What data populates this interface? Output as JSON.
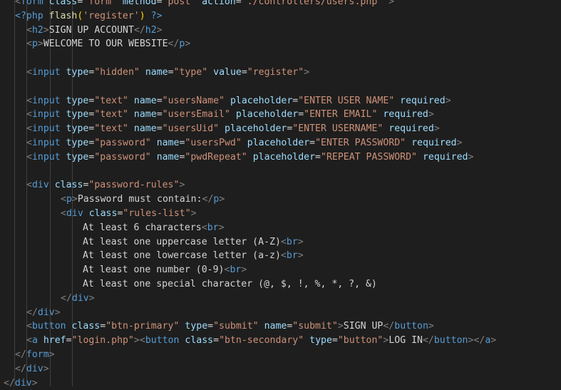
{
  "colors": {
    "background": "#1e1e1e",
    "tag_bracket": "#808080",
    "tag_name": "#569cd6",
    "attribute": "#9cdcfe",
    "string": "#ce9178",
    "text": "#d4d4d4",
    "function": "#dcdcaa",
    "paren": "#ffd700"
  },
  "lines": [
    {
      "indent": 1,
      "tokens": [
        [
          "punc",
          "<"
        ],
        [
          "tag",
          "form"
        ],
        [
          "text",
          " "
        ],
        [
          "attr",
          "class"
        ],
        [
          "eq",
          "="
        ],
        [
          "str",
          "\"form\""
        ],
        [
          "text",
          " "
        ],
        [
          "attr",
          "method"
        ],
        [
          "eq",
          "="
        ],
        [
          "str",
          "\"post\""
        ],
        [
          "text",
          " "
        ],
        [
          "attr",
          "action"
        ],
        [
          "eq",
          "="
        ],
        [
          "str",
          "\"./controllers/users.php\""
        ],
        [
          "text",
          " "
        ],
        [
          "punc",
          ">"
        ]
      ]
    },
    {
      "indent": 1,
      "tokens": [
        [
          "php",
          "<?php"
        ],
        [
          "text",
          " "
        ],
        [
          "fn",
          "flash"
        ],
        [
          "paren",
          "("
        ],
        [
          "str",
          "'register'"
        ],
        [
          "paren",
          ")"
        ],
        [
          "text",
          " "
        ],
        [
          "php",
          "?>"
        ]
      ]
    },
    {
      "indent": 2,
      "tokens": [
        [
          "punc",
          "<"
        ],
        [
          "tag",
          "h2"
        ],
        [
          "punc",
          ">"
        ],
        [
          "text",
          "SIGN UP ACCOUNT"
        ],
        [
          "punc",
          "</"
        ],
        [
          "tag",
          "h2"
        ],
        [
          "punc",
          ">"
        ]
      ]
    },
    {
      "indent": 2,
      "tokens": [
        [
          "punc",
          "<"
        ],
        [
          "tag",
          "p"
        ],
        [
          "punc",
          ">"
        ],
        [
          "text",
          "WELCOME TO OUR WEBSITE"
        ],
        [
          "punc",
          "</"
        ],
        [
          "tag",
          "p"
        ],
        [
          "punc",
          ">"
        ]
      ]
    },
    {
      "indent": 0,
      "tokens": []
    },
    {
      "indent": 2,
      "tokens": [
        [
          "punc",
          "<"
        ],
        [
          "tag",
          "input"
        ],
        [
          "text",
          " "
        ],
        [
          "attr",
          "type"
        ],
        [
          "eq",
          "="
        ],
        [
          "str",
          "\"hidden\""
        ],
        [
          "text",
          " "
        ],
        [
          "attr",
          "name"
        ],
        [
          "eq",
          "="
        ],
        [
          "str",
          "\"type\""
        ],
        [
          "text",
          " "
        ],
        [
          "attr",
          "value"
        ],
        [
          "eq",
          "="
        ],
        [
          "str",
          "\"register\""
        ],
        [
          "punc",
          ">"
        ]
      ]
    },
    {
      "indent": 0,
      "tokens": []
    },
    {
      "indent": 2,
      "tokens": [
        [
          "punc",
          "<"
        ],
        [
          "tag",
          "input"
        ],
        [
          "text",
          " "
        ],
        [
          "attr",
          "type"
        ],
        [
          "eq",
          "="
        ],
        [
          "str",
          "\"text\""
        ],
        [
          "text",
          " "
        ],
        [
          "attr",
          "name"
        ],
        [
          "eq",
          "="
        ],
        [
          "str",
          "\"usersName\""
        ],
        [
          "text",
          " "
        ],
        [
          "attr",
          "placeholder"
        ],
        [
          "eq",
          "="
        ],
        [
          "str",
          "\"ENTER USER NAME\""
        ],
        [
          "text",
          " "
        ],
        [
          "attr",
          "required"
        ],
        [
          "punc",
          ">"
        ]
      ]
    },
    {
      "indent": 2,
      "tokens": [
        [
          "punc",
          "<"
        ],
        [
          "tag",
          "input"
        ],
        [
          "text",
          " "
        ],
        [
          "attr",
          "type"
        ],
        [
          "eq",
          "="
        ],
        [
          "str",
          "\"text\""
        ],
        [
          "text",
          " "
        ],
        [
          "attr",
          "name"
        ],
        [
          "eq",
          "="
        ],
        [
          "str",
          "\"usersEmail\""
        ],
        [
          "text",
          " "
        ],
        [
          "attr",
          "placeholder"
        ],
        [
          "eq",
          "="
        ],
        [
          "str",
          "\"ENTER EMAIL\""
        ],
        [
          "text",
          " "
        ],
        [
          "attr",
          "required"
        ],
        [
          "punc",
          ">"
        ]
      ]
    },
    {
      "indent": 2,
      "tokens": [
        [
          "punc",
          "<"
        ],
        [
          "tag",
          "input"
        ],
        [
          "text",
          " "
        ],
        [
          "attr",
          "type"
        ],
        [
          "eq",
          "="
        ],
        [
          "str",
          "\"text\""
        ],
        [
          "text",
          " "
        ],
        [
          "attr",
          "name"
        ],
        [
          "eq",
          "="
        ],
        [
          "str",
          "\"usersUid\""
        ],
        [
          "text",
          " "
        ],
        [
          "attr",
          "placeholder"
        ],
        [
          "eq",
          "="
        ],
        [
          "str",
          "\"ENTER USERNAME\""
        ],
        [
          "text",
          " "
        ],
        [
          "attr",
          "required"
        ],
        [
          "punc",
          ">"
        ]
      ]
    },
    {
      "indent": 2,
      "tokens": [
        [
          "punc",
          "<"
        ],
        [
          "tag",
          "input"
        ],
        [
          "text",
          " "
        ],
        [
          "attr",
          "type"
        ],
        [
          "eq",
          "="
        ],
        [
          "str",
          "\"password\""
        ],
        [
          "text",
          " "
        ],
        [
          "attr",
          "name"
        ],
        [
          "eq",
          "="
        ],
        [
          "str",
          "\"usersPwd\""
        ],
        [
          "text",
          " "
        ],
        [
          "attr",
          "placeholder"
        ],
        [
          "eq",
          "="
        ],
        [
          "str",
          "\"ENTER PASSWORD\""
        ],
        [
          "text",
          " "
        ],
        [
          "attr",
          "required"
        ],
        [
          "punc",
          ">"
        ]
      ]
    },
    {
      "indent": 2,
      "tokens": [
        [
          "punc",
          "<"
        ],
        [
          "tag",
          "input"
        ],
        [
          "text",
          " "
        ],
        [
          "attr",
          "type"
        ],
        [
          "eq",
          "="
        ],
        [
          "str",
          "\"password\""
        ],
        [
          "text",
          " "
        ],
        [
          "attr",
          "name"
        ],
        [
          "eq",
          "="
        ],
        [
          "str",
          "\"pwdRepeat\""
        ],
        [
          "text",
          " "
        ],
        [
          "attr",
          "placeholder"
        ],
        [
          "eq",
          "="
        ],
        [
          "str",
          "\"REPEAT PASSWORD\""
        ],
        [
          "text",
          " "
        ],
        [
          "attr",
          "required"
        ],
        [
          "punc",
          ">"
        ]
      ]
    },
    {
      "indent": 0,
      "tokens": []
    },
    {
      "indent": 2,
      "tokens": [
        [
          "punc",
          "<"
        ],
        [
          "tag",
          "div"
        ],
        [
          "text",
          " "
        ],
        [
          "attr",
          "class"
        ],
        [
          "eq",
          "="
        ],
        [
          "str",
          "\"password-rules\""
        ],
        [
          "punc",
          ">"
        ]
      ]
    },
    {
      "indent": 3,
      "tokens": [
        [
          "punc",
          "<"
        ],
        [
          "tag",
          "p"
        ],
        [
          "punc",
          ">"
        ],
        [
          "text",
          "Password must contain:"
        ],
        [
          "punc",
          "</"
        ],
        [
          "tag",
          "p"
        ],
        [
          "punc",
          ">"
        ]
      ]
    },
    {
      "indent": 3,
      "tokens": [
        [
          "punc",
          "<"
        ],
        [
          "tag",
          "div"
        ],
        [
          "text",
          " "
        ],
        [
          "attr",
          "class"
        ],
        [
          "eq",
          "="
        ],
        [
          "str",
          "\"rules-list\""
        ],
        [
          "punc",
          ">"
        ]
      ]
    },
    {
      "indent": 4,
      "tokens": [
        [
          "text",
          "At least 6 characters"
        ],
        [
          "punc",
          "<"
        ],
        [
          "tag",
          "br"
        ],
        [
          "punc",
          ">"
        ]
      ]
    },
    {
      "indent": 4,
      "tokens": [
        [
          "text",
          "At least one uppercase letter (A-Z)"
        ],
        [
          "punc",
          "<"
        ],
        [
          "tag",
          "br"
        ],
        [
          "punc",
          ">"
        ]
      ]
    },
    {
      "indent": 4,
      "tokens": [
        [
          "text",
          "At least one lowercase letter (a-z)"
        ],
        [
          "punc",
          "<"
        ],
        [
          "tag",
          "br"
        ],
        [
          "punc",
          ">"
        ]
      ]
    },
    {
      "indent": 4,
      "tokens": [
        [
          "text",
          "At least one number (0-9)"
        ],
        [
          "punc",
          "<"
        ],
        [
          "tag",
          "br"
        ],
        [
          "punc",
          ">"
        ]
      ]
    },
    {
      "indent": 4,
      "tokens": [
        [
          "text",
          "At least one special character (@, $, !, %, *, ?, &)"
        ]
      ]
    },
    {
      "indent": 3,
      "tokens": [
        [
          "punc",
          "</"
        ],
        [
          "tag",
          "div"
        ],
        [
          "punc",
          ">"
        ]
      ]
    },
    {
      "indent": 2,
      "tokens": [
        [
          "punc",
          "</"
        ],
        [
          "tag",
          "div"
        ],
        [
          "punc",
          ">"
        ]
      ]
    },
    {
      "indent": 2,
      "tokens": [
        [
          "punc",
          "<"
        ],
        [
          "tag",
          "button"
        ],
        [
          "text",
          " "
        ],
        [
          "attr",
          "class"
        ],
        [
          "eq",
          "="
        ],
        [
          "str",
          "\"btn-primary\""
        ],
        [
          "text",
          " "
        ],
        [
          "attr",
          "type"
        ],
        [
          "eq",
          "="
        ],
        [
          "str",
          "\"submit\""
        ],
        [
          "text",
          " "
        ],
        [
          "attr",
          "name"
        ],
        [
          "eq",
          "="
        ],
        [
          "str",
          "\"submit\""
        ],
        [
          "punc",
          ">"
        ],
        [
          "text",
          "SIGN UP"
        ],
        [
          "punc",
          "</"
        ],
        [
          "tag",
          "button"
        ],
        [
          "punc",
          ">"
        ]
      ]
    },
    {
      "indent": 2,
      "tokens": [
        [
          "punc",
          "<"
        ],
        [
          "tag",
          "a"
        ],
        [
          "text",
          " "
        ],
        [
          "attr",
          "href"
        ],
        [
          "eq",
          "="
        ],
        [
          "str",
          "\"login.php\""
        ],
        [
          "punc",
          ">"
        ],
        [
          "punc",
          "<"
        ],
        [
          "tag",
          "button"
        ],
        [
          "text",
          " "
        ],
        [
          "attr",
          "class"
        ],
        [
          "eq",
          "="
        ],
        [
          "str",
          "\"btn-secondary\""
        ],
        [
          "text",
          " "
        ],
        [
          "attr",
          "type"
        ],
        [
          "eq",
          "="
        ],
        [
          "str",
          "\"button\""
        ],
        [
          "punc",
          ">"
        ],
        [
          "text",
          "LOG IN"
        ],
        [
          "punc",
          "</"
        ],
        [
          "tag",
          "button"
        ],
        [
          "punc",
          ">"
        ],
        [
          "punc",
          "</"
        ],
        [
          "tag",
          "a"
        ],
        [
          "punc",
          ">"
        ]
      ]
    },
    {
      "indent": 1,
      "tokens": [
        [
          "punc",
          "</"
        ],
        [
          "tag",
          "form"
        ],
        [
          "punc",
          ">"
        ]
      ]
    },
    {
      "indent": 1,
      "tokens": [
        [
          "punc",
          "</"
        ],
        [
          "tag",
          "div"
        ],
        [
          "punc",
          ">"
        ]
      ]
    },
    {
      "indent": 0,
      "tokens": [
        [
          "punc",
          "</"
        ],
        [
          "tag",
          "div"
        ],
        [
          "punc",
          ">"
        ]
      ]
    }
  ]
}
